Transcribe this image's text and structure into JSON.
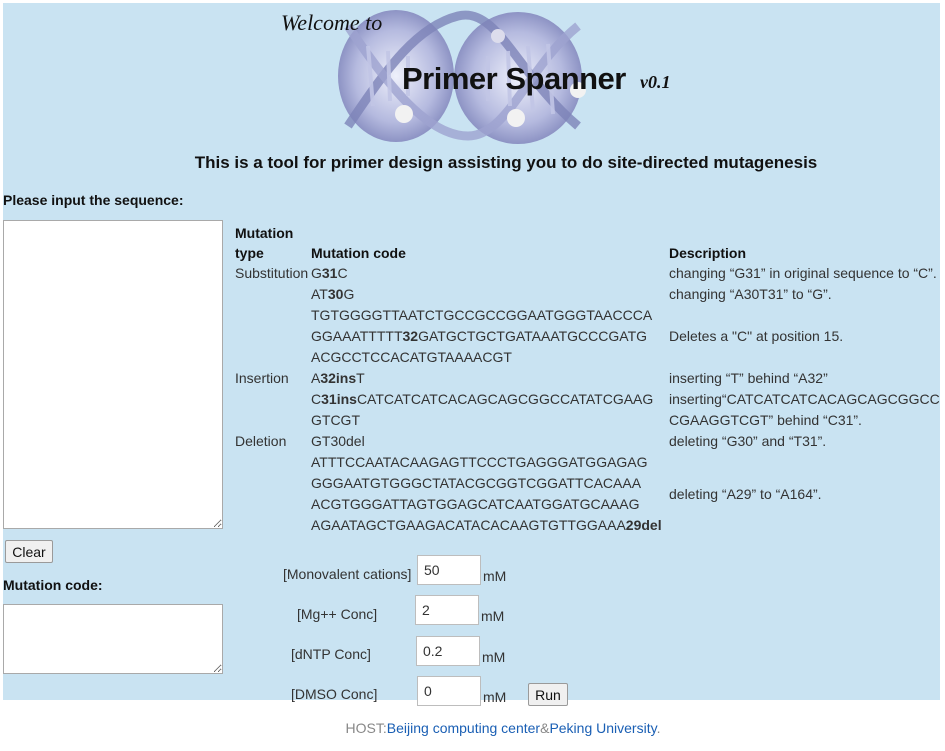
{
  "banner": {
    "welcome": "Welcome to",
    "title": "Primer Spanner",
    "version": "v0.1"
  },
  "headline": "This is a tool for primer design assisting you to do site-directed mutagenesis",
  "sequence": {
    "label": "Please input the sequence:",
    "value": "",
    "clear_label": "Clear"
  },
  "mutation_code": {
    "label": "Mutation code:",
    "value": ""
  },
  "table": {
    "headers": {
      "type": "Mutation type",
      "code": "Mutation code",
      "description": "Description"
    },
    "rows": [
      {
        "type": "Substitution",
        "code_parts": [
          "G",
          "31",
          "C"
        ],
        "description": "changing “G31” in original sequence to “C”."
      },
      {
        "type": "",
        "code_parts": [
          "AT",
          "30",
          "G"
        ],
        "description": "changing “A30T31” to “G”."
      },
      {
        "type": "",
        "code_lines": [
          "TGTGGGGTTAATCTGCCGCCGGAATGGGTAACCCA",
          "GGAAATTTTT32GATGCTGCTGATAAATGCCCGATG",
          "ACGCCTCCACATGTAAAACGT"
        ],
        "code_line2_parts": [
          "GGAAATTTTT",
          "32",
          "GATGCTGCTGATAAATGCCCGATG"
        ],
        "description": "Deletes a \"C\" at position 15."
      },
      {
        "type": "Insertion",
        "code_parts": [
          "A",
          "32ins",
          "T"
        ],
        "description": "inserting “T” behind “A32”"
      },
      {
        "type": "",
        "code_parts": [
          "C",
          "31ins",
          "CATCATCATCACAGCAGCGGCCATATCGAAG"
        ],
        "code_line2": "GTCGT",
        "description_lines": [
          "inserting“CATCATCATCACAGCAGCGGCC",
          "CGAAGGTCGT” behind “C31”."
        ]
      },
      {
        "type": "Deletion",
        "code": "GT30del",
        "description": "deleting “G30” and “T31”."
      },
      {
        "type": "",
        "code_lines": [
          "ATTTCCAATACAAGAGTTCCCTGAGGGATGGAGAG",
          "GGGAATGTGGGCTATACGCGGTCGGATTCACAAA",
          "ACGTGGGATTAGTGGAGCATCAATGGATGCAAAG"
        ],
        "code_last_parts": [
          "AGAATAGCTGAAGACATACACAAGTGTTGGAAA",
          "29del"
        ],
        "description": "deleting “A29” to “A164”."
      }
    ]
  },
  "params": {
    "monovalent": {
      "label": "[Monovalent cations]",
      "value": "50",
      "unit": "mM"
    },
    "mg": {
      "label": "[Mg++ Conc]",
      "value": "2",
      "unit": "mM"
    },
    "dntp": {
      "label": "[dNTP Conc]",
      "value": "0.2",
      "unit": "mM"
    },
    "dmso": {
      "label": "[DMSO Conc]",
      "value": "0",
      "unit": "mM"
    },
    "run_label": "Run"
  },
  "footer": {
    "host_prefix": "HOST:",
    "link1": "Beijing computing center",
    "amp": "&",
    "link2": "Peking University",
    "suffix": "."
  }
}
